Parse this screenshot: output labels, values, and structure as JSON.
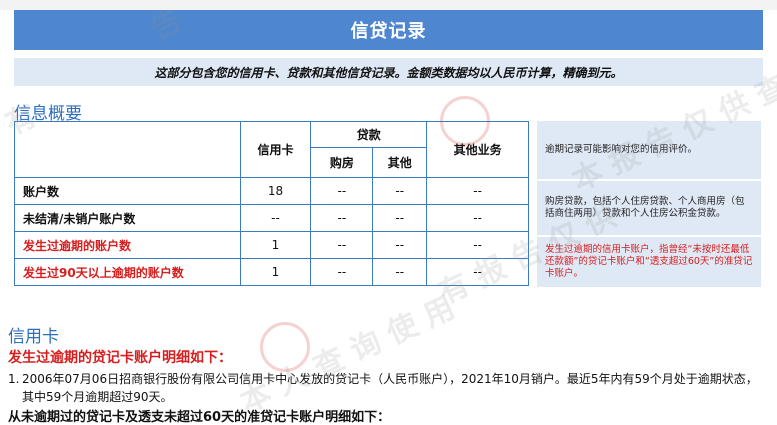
{
  "header": {
    "title": "信贷记录"
  },
  "subtitle": "这部分包含您的信用卡、贷款和其他信贷记录。金额类数据均以人民币计算，精确到元。",
  "overview": {
    "section_title": "信息概要",
    "columns": {
      "credit_card": "信用卡",
      "loan": "贷款",
      "housing": "购房",
      "other": "其他",
      "other_business": "其他业务"
    },
    "rows": [
      {
        "label": "账户数",
        "credit_card": "18",
        "housing": "--",
        "other": "--",
        "other_business": "--",
        "red": false
      },
      {
        "label": "未结清/未销户账户数",
        "credit_card": "--",
        "housing": "--",
        "other": "--",
        "other_business": "--",
        "red": false
      },
      {
        "label": "发生过逾期的账户数",
        "credit_card": "1",
        "housing": "--",
        "other": "--",
        "other_business": "--",
        "red": true
      },
      {
        "label": "发生过90天以上逾期的账户数",
        "credit_card": "1",
        "housing": "--",
        "other": "--",
        "other_business": "--",
        "red": true
      }
    ],
    "notes": [
      "逾期记录可能影响对您的信用评价。",
      "购房贷款，包括个人住房贷款、个人商用房（包括商住两用）贷款和个人住房公积金贷款。",
      "发生过逾期的信用卡账户，指曾经“未按时还最低还款额”的贷记卡账户和“透支超过60天”的准贷记卡账户。"
    ]
  },
  "credit_card": {
    "section_title": "信用卡",
    "overdue_heading": "发生过逾期的贷记卡账户明细如下：",
    "details": [
      {
        "num": "1.",
        "text": "2006年07月06日招商银行股份有限公司信用卡中心发放的贷记卡（人民币账户），2021年10月销户。最近5年内有59个月处于逾期状态，其中59个月逾期超过90天。"
      }
    ],
    "cutoff_text": "从未逾期过的贷记卡及透支未超过60天的准贷记卡账户明细如下："
  }
}
